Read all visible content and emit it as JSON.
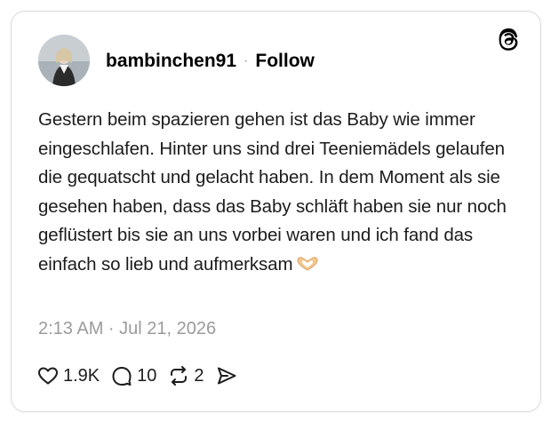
{
  "post": {
    "username": "bambinchen91",
    "separator": "·",
    "follow_label": "Follow",
    "text": "Gestern beim spazieren gehen ist das Baby wie immer eingeschlafen. Hinter uns sind drei Teeniemädels gelaufen die gequatscht und gelacht haben. In dem Moment als sie gesehen haben, dass das Baby schläft haben sie nur noch geflüstert bis sie an uns vorbei waren und ich fand das einfach so lieb und aufmerksam",
    "emoji": "heart-hands-emoji",
    "timestamp": "2:13 AM · Jul 21, 2026"
  },
  "actions": {
    "likes": "1.9K",
    "replies": "10",
    "reposts": "2"
  },
  "icons": {
    "logo": "threads-logo-icon",
    "like": "heart-icon",
    "reply": "speech-bubble-icon",
    "repost": "repost-icon",
    "share": "send-icon"
  },
  "colors": {
    "text": "#1c1c1c",
    "muted": "#9b9b9b",
    "border": "#d9d9d9"
  }
}
